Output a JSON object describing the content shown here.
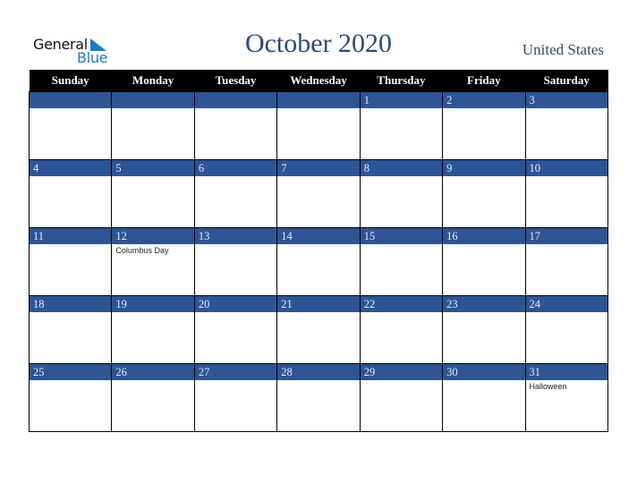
{
  "logo": {
    "line1": "General",
    "line2": "Blue"
  },
  "title": "October 2020",
  "country": "United States",
  "colors": {
    "band": "#2e5496",
    "header": "#000000",
    "title": "#2a4a7a",
    "logo_blue": "#1f7bc0"
  },
  "weekdays": [
    "Sunday",
    "Monday",
    "Tuesday",
    "Wednesday",
    "Thursday",
    "Friday",
    "Saturday"
  ],
  "weeks": [
    [
      {
        "day": "",
        "event": ""
      },
      {
        "day": "",
        "event": ""
      },
      {
        "day": "",
        "event": ""
      },
      {
        "day": "",
        "event": ""
      },
      {
        "day": "1",
        "event": ""
      },
      {
        "day": "2",
        "event": ""
      },
      {
        "day": "3",
        "event": ""
      }
    ],
    [
      {
        "day": "4",
        "event": ""
      },
      {
        "day": "5",
        "event": ""
      },
      {
        "day": "6",
        "event": ""
      },
      {
        "day": "7",
        "event": ""
      },
      {
        "day": "8",
        "event": ""
      },
      {
        "day": "9",
        "event": ""
      },
      {
        "day": "10",
        "event": ""
      }
    ],
    [
      {
        "day": "11",
        "event": ""
      },
      {
        "day": "12",
        "event": "Columbus Day"
      },
      {
        "day": "13",
        "event": ""
      },
      {
        "day": "14",
        "event": ""
      },
      {
        "day": "15",
        "event": ""
      },
      {
        "day": "16",
        "event": ""
      },
      {
        "day": "17",
        "event": ""
      }
    ],
    [
      {
        "day": "18",
        "event": ""
      },
      {
        "day": "19",
        "event": ""
      },
      {
        "day": "20",
        "event": ""
      },
      {
        "day": "21",
        "event": ""
      },
      {
        "day": "22",
        "event": ""
      },
      {
        "day": "23",
        "event": ""
      },
      {
        "day": "24",
        "event": ""
      }
    ],
    [
      {
        "day": "25",
        "event": ""
      },
      {
        "day": "26",
        "event": ""
      },
      {
        "day": "27",
        "event": ""
      },
      {
        "day": "28",
        "event": ""
      },
      {
        "day": "29",
        "event": ""
      },
      {
        "day": "30",
        "event": ""
      },
      {
        "day": "31",
        "event": "Halloween"
      }
    ]
  ]
}
